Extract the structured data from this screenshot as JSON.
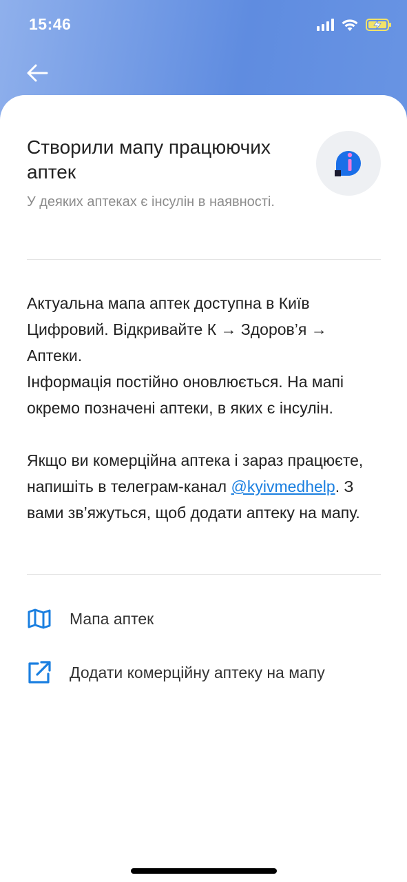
{
  "status_bar": {
    "time": "15:46",
    "icons": [
      "signal-icon",
      "wifi-icon",
      "battery-charging-icon"
    ]
  },
  "nav": {
    "back_icon": "arrow-left-icon"
  },
  "header": {
    "title": "Створили мапу працюючих аптек",
    "subtitle": "У деяких аптеках є інсулін в наявності.",
    "logo_icon": "info-logo-icon"
  },
  "body": {
    "paragraph1_line1": "Актуальна мапа аптек доступна в Київ Цифровий. Відкривайте К → Здоров’я → Аптеки.",
    "paragraph1_line2": "Інформація постійно оновлюється. На мапі окремо позначені аптеки, в яких є інсулін.",
    "paragraph2_before": "Якщо ви комерційна аптека і зараз працюєте, напишіть в телеграм-канал ",
    "paragraph2_link": "@kyivmedhelp",
    "paragraph2_after": ". З вами зв’яжуться, щоб додати аптеку на мапу."
  },
  "actions": [
    {
      "label": "Мапа аптек",
      "icon": "map-icon"
    },
    {
      "label": "Додати комерційну аптеку на мапу",
      "icon": "external-link-icon"
    }
  ],
  "colors": {
    "accent": "#1a7fe0",
    "header_gradient_start": "#8fb0ec",
    "header_gradient_end": "#5f8ce0",
    "logo_blue": "#1a6fe8",
    "logo_pink": "#f07ad8"
  }
}
